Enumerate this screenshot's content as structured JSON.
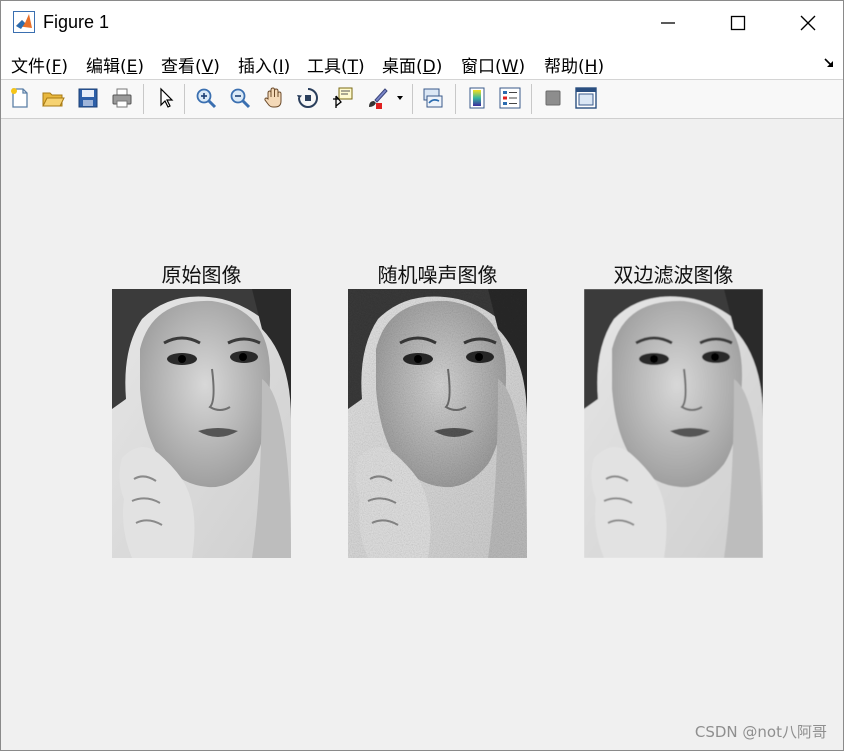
{
  "window": {
    "title": "Figure 1",
    "controls": [
      "minimize",
      "maximize",
      "close"
    ]
  },
  "menu": [
    {
      "label": "文件(",
      "key": "F",
      "end": ")"
    },
    {
      "label": "编辑(",
      "key": "E",
      "end": ")"
    },
    {
      "label": "查看(",
      "key": "V",
      "end": ")"
    },
    {
      "label": "插入(",
      "key": "I",
      "end": ")"
    },
    {
      "label": "工具(",
      "key": "T",
      "end": ")"
    },
    {
      "label": "桌面(",
      "key": "D",
      "end": ")"
    },
    {
      "label": "窗口(",
      "key": "W",
      "end": ")"
    },
    {
      "label": "帮助(",
      "key": "H",
      "end": ")"
    }
  ],
  "toolbar": {
    "buttons": [
      "new-figure-icon",
      "open-file-icon",
      "save-icon",
      "print-icon",
      "select-arrow-icon",
      "zoom-in-icon",
      "zoom-out-icon",
      "pan-hand-icon",
      "rotate-3d-icon",
      "data-cursor-icon",
      "brush-icon",
      "brush-dropdown-icon",
      "link-plot-icon",
      "colorbar-icon",
      "legend-icon",
      "hide-plot-tools-icon",
      "show-plot-tools-icon"
    ]
  },
  "figure": {
    "subplots": [
      {
        "title": "原始图像",
        "noise": "none"
      },
      {
        "title": "随机噪声图像",
        "noise": "random"
      },
      {
        "title": "双边滤波图像",
        "noise": "smoothed"
      }
    ]
  },
  "watermark": "CSDN @not八阿哥",
  "colors": {
    "titlebar": "#ffffff",
    "figure_background": "#f0f0f0",
    "matlab_orange": "#e8702a",
    "matlab_blue": "#2b6cb0"
  }
}
